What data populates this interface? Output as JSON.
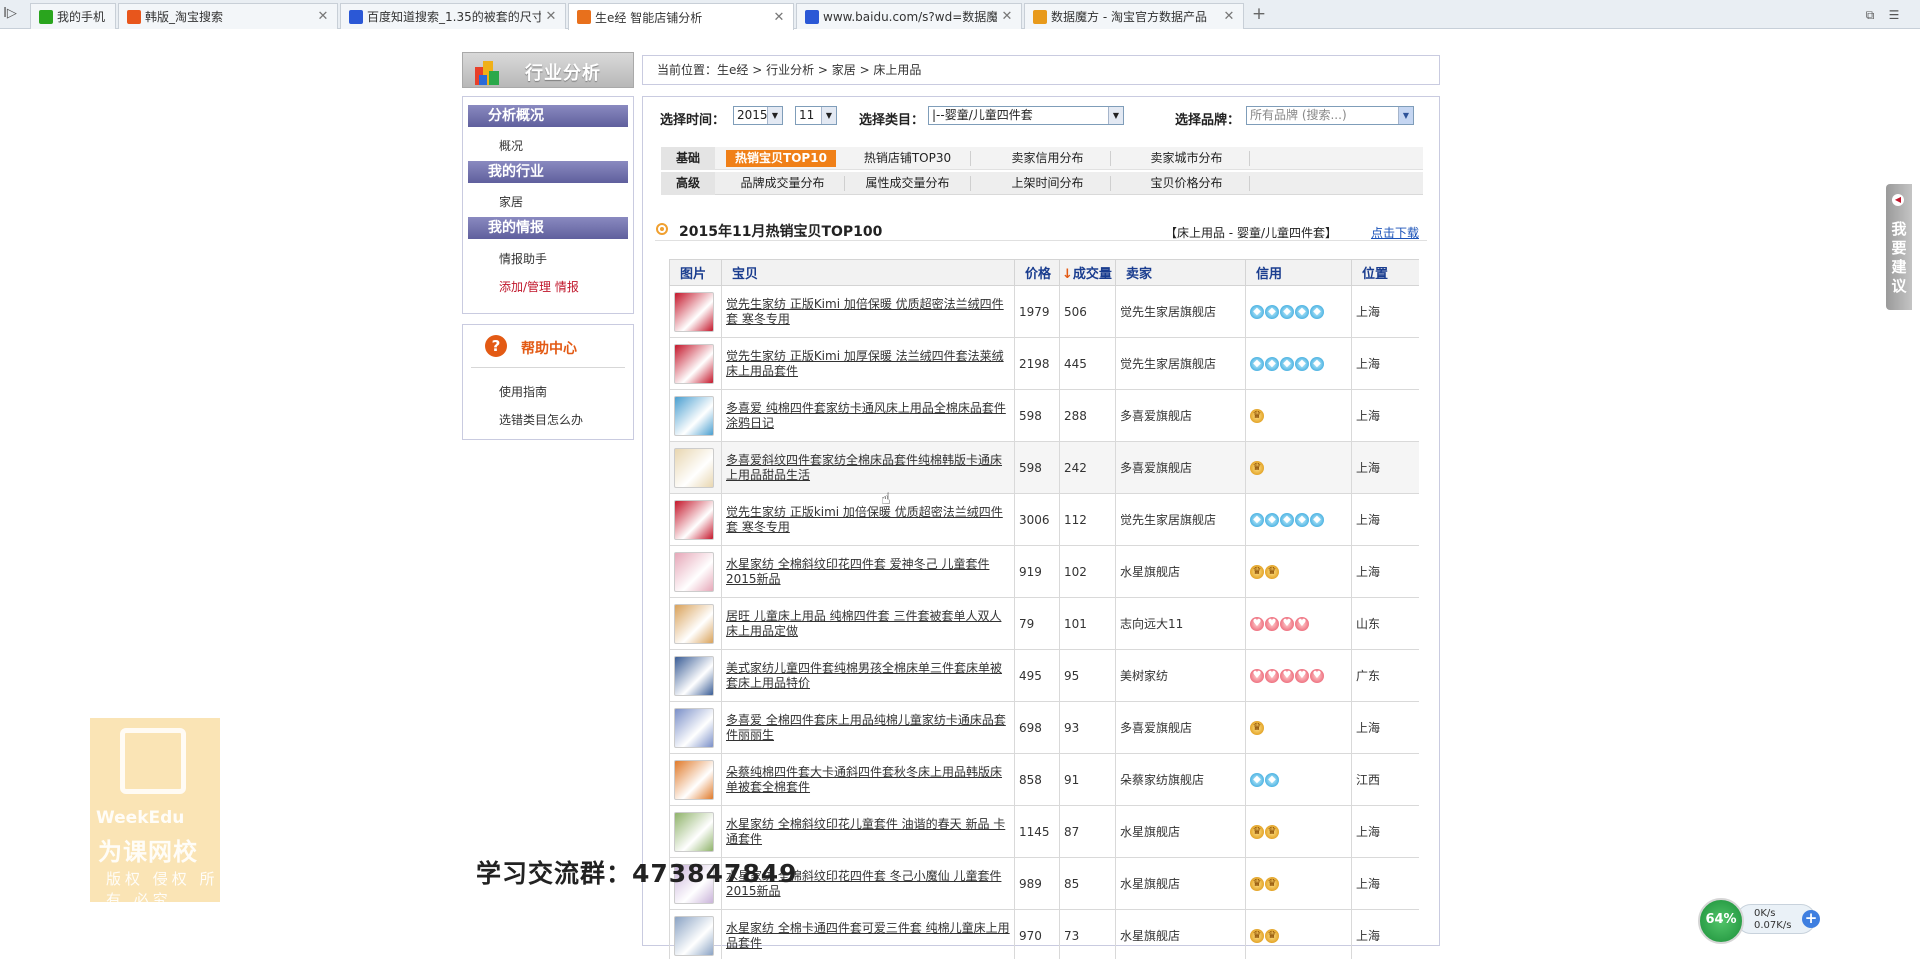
{
  "browser": {
    "tabs": [
      {
        "label": "我的手机",
        "active": false,
        "icon": "phone-icon",
        "color": "#2aa51e"
      },
      {
        "label": "韩版_淘宝搜索",
        "active": false,
        "icon": "taobao-icon",
        "color": "#e8561c"
      },
      {
        "label": "百度知道搜索_1.35的被套的尺寸",
        "active": false,
        "icon": "baidu-icon",
        "color": "#2b58d6"
      },
      {
        "label": "生e经 智能店铺分析",
        "active": true,
        "icon": "shengejing-icon",
        "color": "#e8701c"
      },
      {
        "label": "www.baidu.com/s?wd=数据魔方",
        "active": false,
        "icon": "baidu-icon",
        "color": "#2b58d6"
      },
      {
        "label": "数据魔方 - 淘宝官方数据产品",
        "active": false,
        "icon": "chart-icon",
        "color": "#e89a1c"
      }
    ],
    "new_tab": "+",
    "nav_arrow": "I▷"
  },
  "logo": {
    "text": "行业分析"
  },
  "sidebar": {
    "sections": [
      {
        "title": "分析概况",
        "items": [
          {
            "label": "概况"
          }
        ]
      },
      {
        "title": "我的行业",
        "items": [
          {
            "label": "家居"
          }
        ]
      },
      {
        "title": "我的情报",
        "items": [
          {
            "label": "情报助手"
          },
          {
            "label": "添加/管理 情报"
          }
        ]
      }
    ]
  },
  "help": {
    "title": "帮助中心",
    "icon_glyph": "?",
    "items": [
      {
        "label": "使用指南"
      },
      {
        "label": "选错类目怎么办"
      }
    ]
  },
  "breadcrumb": "当前位置：生e经 > 行业分析 > 家居 > 床上用品",
  "filters": {
    "time_label": "选择时间：",
    "year": "2015",
    "month": "11",
    "category_label": "选择类目：",
    "category": "|--婴童/儿童四件套",
    "brand_label": "选择品牌：",
    "brand_placeholder": "所有品牌 (搜索...)"
  },
  "report_tabs": {
    "row1": {
      "category": "基础",
      "items": [
        "热销宝贝TOP10",
        "热销店铺TOP30",
        "卖家信用分布",
        "卖家城市分布"
      ],
      "active_index": 0
    },
    "row2": {
      "category": "高级",
      "items": [
        "品牌成交量分布",
        "属性成交量分布",
        "上架时间分布",
        "宝贝价格分布"
      ]
    }
  },
  "section": {
    "title": "2015年11月热销宝贝TOP100",
    "category_tag": "【床上用品 - 婴童/儿童四件套】",
    "download_link": "点击下载"
  },
  "table": {
    "columns": [
      "图片",
      "宝贝",
      "价格",
      "↓成交量",
      "卖家",
      "信用",
      "位置"
    ],
    "sort_arrow": "↓",
    "rows": [
      {
        "title": "觉先生家纺 正版Kimi 加倍保暖 优质超密法兰绒四件套 寒冬专用",
        "price": "1979",
        "sales": "506",
        "seller": "觉先生家居旗舰店",
        "credit": {
          "type": "diamond",
          "count": 5
        },
        "location": "上海",
        "thumb_color": "#c4172b"
      },
      {
        "title": "觉先生家纺 正版Kimi 加厚保暖 法兰绒四件套法莱绒床上用品套件",
        "price": "2198",
        "sales": "445",
        "seller": "觉先生家居旗舰店",
        "credit": {
          "type": "diamond",
          "count": 5
        },
        "location": "上海",
        "thumb_color": "#c4172b"
      },
      {
        "title": "多喜爱 纯棉四件套家纺卡通风床上用品全棉床品套件涂鸦日记",
        "price": "598",
        "sales": "288",
        "seller": "多喜爱旗舰店",
        "credit": {
          "type": "crown",
          "count": 1
        },
        "location": "上海",
        "thumb_color": "#4a9fd0"
      },
      {
        "title": "多喜爱斜纹四件套家纺全棉床品套件纯棉韩版卡通床上用品甜品生活",
        "price": "598",
        "sales": "242",
        "seller": "多喜爱旗舰店",
        "credit": {
          "type": "crown",
          "count": 1
        },
        "location": "上海",
        "thumb_color": "#e8d6b0"
      },
      {
        "title": "觉先生家纺 正版kimi 加倍保暖 优质超密法兰绒四件套 寒冬专用",
        "price": "3006",
        "sales": "112",
        "seller": "觉先生家居旗舰店",
        "credit": {
          "type": "diamond",
          "count": 5
        },
        "location": "上海",
        "thumb_color": "#c4172b"
      },
      {
        "title": "水星家纺 全棉斜纹印花四件套 爱神冬己 儿童套件2015新品",
        "price": "919",
        "sales": "102",
        "seller": "水星旗舰店",
        "credit": {
          "type": "crown",
          "count": 2
        },
        "location": "上海",
        "thumb_color": "#e6a7b8"
      },
      {
        "title": "居旺 儿童床上用品 纯棉四件套 三件套被套单人双人床上用品定做",
        "price": "79",
        "sales": "101",
        "seller": "志向远大11",
        "credit": {
          "type": "heart",
          "count": 4
        },
        "location": "山东",
        "thumb_color": "#d9a25a"
      },
      {
        "title": "美式家纺儿童四件套纯棉男孩全棉床单三件套床单被套床上用品特价",
        "price": "495",
        "sales": "95",
        "seller": "美树家纺",
        "credit": {
          "type": "heart",
          "count": 5
        },
        "location": "广东",
        "thumb_color": "#3a5d96"
      },
      {
        "title": "多喜爱 全棉四件套床上用品纯棉儿童家纺卡通床品套件丽丽生",
        "price": "698",
        "sales": "93",
        "seller": "多喜爱旗舰店",
        "credit": {
          "type": "crown",
          "count": 1
        },
        "location": "上海",
        "thumb_color": "#7a8fc8"
      },
      {
        "title": "朵蔡纯棉四件套大卡通斜四件套秋冬床上用品韩版床单被套全棉套件",
        "price": "858",
        "sales": "91",
        "seller": "朵蔡家纺旗舰店",
        "credit": {
          "type": "diamond",
          "count": 2
        },
        "location": "江西",
        "thumb_color": "#e07a2a"
      },
      {
        "title": "水星家纺 全棉斜纹印花儿童套件 油谐的春天 新品 卡通套件",
        "price": "1145",
        "sales": "87",
        "seller": "水星旗舰店",
        "credit": {
          "type": "crown",
          "count": 2
        },
        "location": "上海",
        "thumb_color": "#8fb36a"
      },
      {
        "title": "水星家纺 全棉斜纹印花四件套 冬己小魔仙 儿童套件2015新品",
        "price": "989",
        "sales": "85",
        "seller": "水星旗舰店",
        "credit": {
          "type": "crown",
          "count": 2
        },
        "location": "上海",
        "thumb_color": "#c9b3d9"
      },
      {
        "title": "水星家纺 全棉卡通四件套可爱三件套 纯棉儿童床上用品套件",
        "price": "970",
        "sales": "73",
        "seller": "水星旗舰店",
        "credit": {
          "type": "crown",
          "count": 2
        },
        "location": "上海",
        "thumb_color": "#8aa3c4"
      }
    ]
  },
  "overlays": {
    "watermark": {
      "line1": "WeekEdu",
      "line2": "为课网校",
      "line3": "版权 侵权 所有 必究"
    },
    "qq_group": "学习交流群：473847849",
    "feedback": {
      "text": "我要建议",
      "icon_glyph": "◀"
    },
    "speed": {
      "percent": "64%",
      "up": "0K/s",
      "down": "0.07K/s",
      "plus": "+"
    }
  },
  "colors": {
    "accent_orange": "#f08018",
    "sidebar_head": "#6a6aa8",
    "link_blue": "#1a52b8"
  }
}
